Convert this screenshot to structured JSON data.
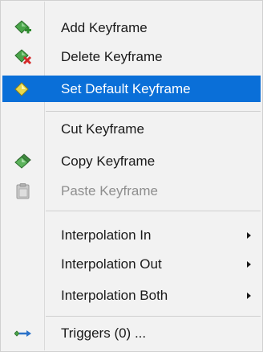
{
  "menu": {
    "items": [
      {
        "label": "Add Keyframe",
        "icon": "add-keyframe-icon"
      },
      {
        "label": "Delete Keyframe",
        "icon": "delete-keyframe-icon"
      },
      {
        "label": "Set Default Keyframe",
        "icon": "set-default-keyframe-icon",
        "state": "selected"
      },
      {
        "label": "Cut Keyframe",
        "icon": ""
      },
      {
        "label": "Copy Keyframe",
        "icon": "copy-keyframe-icon"
      },
      {
        "label": "Paste Keyframe",
        "icon": "paste-keyframe-icon",
        "state": "disabled"
      },
      {
        "label": "Interpolation In",
        "submenu": true
      },
      {
        "label": "Interpolation Out",
        "submenu": true
      },
      {
        "label": "Interpolation Both",
        "submenu": true
      },
      {
        "label": "Triggers (0) ...",
        "icon": "triggers-icon"
      }
    ]
  },
  "colors": {
    "menu_background": "#f2f2f2",
    "selection": "#0a6fd8",
    "keyframe_green": "#3f9a3f",
    "keyframe_yellow": "#e8d84a",
    "delete_red": "#d42a2a",
    "trigger_blue": "#2b72c9"
  }
}
